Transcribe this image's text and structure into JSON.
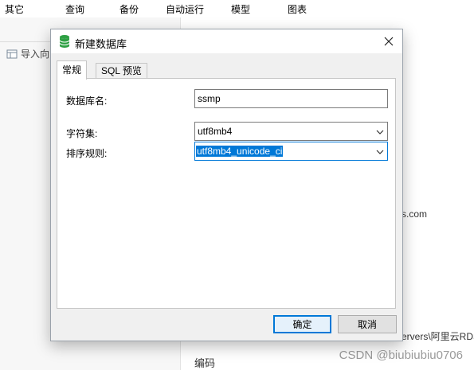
{
  "background": {
    "menu": [
      "其它",
      "查询",
      "备份",
      "自动运行",
      "模型",
      "图表"
    ],
    "import_label": "导入向",
    "right_text_1": "s.com",
    "right_text_2": "ervers\\阿里云RDS",
    "right_text_3": "编码",
    "watermark": "CSDN @biubiubiu0706"
  },
  "dialog": {
    "title": "新建数据库",
    "tabs": [
      {
        "label": "常规",
        "active": true
      },
      {
        "label": "SQL 预览",
        "active": false
      }
    ],
    "fields": {
      "db_name_label": "数据库名:",
      "db_name_value": "ssmp",
      "charset_label": "字符集:",
      "charset_value": "utf8mb4",
      "collation_label": "排序规则:",
      "collation_value": "utf8mb4_unicode_ci"
    },
    "buttons": {
      "ok": "确定",
      "cancel": "取消"
    },
    "colors": {
      "accent": "#0078d7",
      "db_icon": "#2ea043"
    }
  }
}
